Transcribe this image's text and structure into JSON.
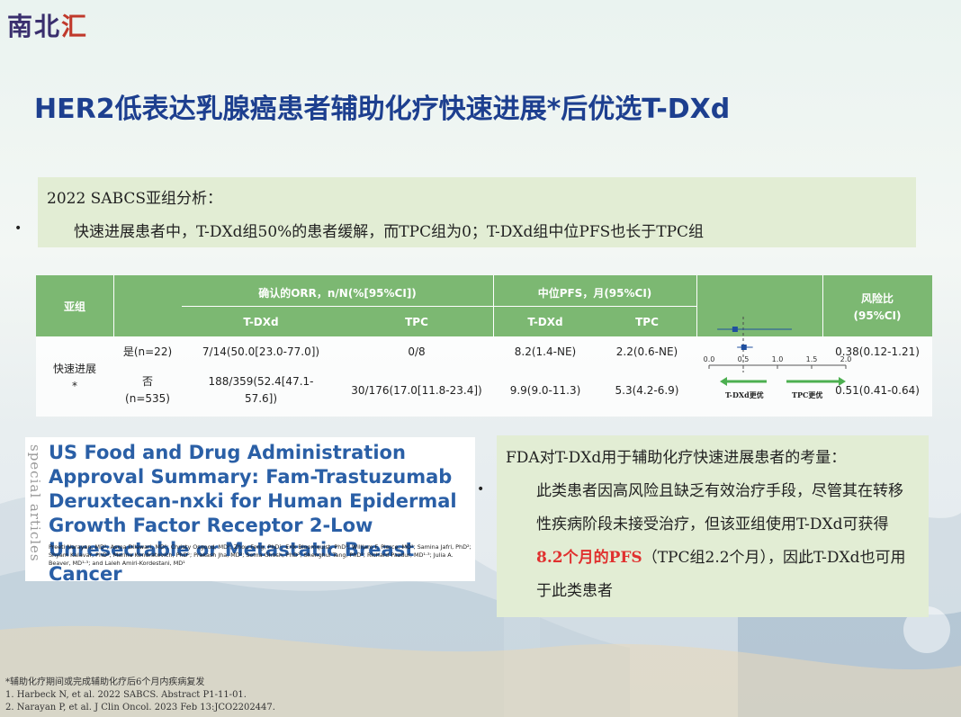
{
  "logo": {
    "part1": "南北",
    "part2": "汇"
  },
  "title": "HER2低表达乳腺癌患者辅助化疗快速进展*后优选T-DXd",
  "summary": {
    "heading": "2022 SABCS亚组分析：",
    "bullet": "•",
    "text": "快速进展患者中，T-DXd组50%的患者缓解，而TPC组为0；T-DXd组中位PFS也长于TPC组"
  },
  "table": {
    "col_subgroup": "亚组",
    "col_orr": "确认的ORR，n/N(%[95%CI])",
    "col_pfs": "中位PFS，月(95%CI)",
    "col_hr": "风险比",
    "col_hr_ci": "(95%CI)",
    "sub_tdxd": "T-DXd",
    "sub_tpc": "TPC",
    "sub_tdxd2": "T-DXd",
    "sub_tpc2": "TPC",
    "group_label": "快速进展",
    "group_star": "*",
    "rows": [
      {
        "label": "是(n=22)",
        "orr_tdxd": "7/14(50.0[23.0-77.0])",
        "orr_tpc": "0/8",
        "pfs_tdxd": "8.2(1.4-NE)",
        "pfs_tpc": "2.2(0.6-NE)",
        "hr": "0.38(0.12-1.21)"
      },
      {
        "label": "否",
        "label2": "(n=535)",
        "orr_tdxd": "188/359(52.4[47.1-",
        "orr_tdxd2": "57.6])",
        "orr_tpc": "30/176(17.0[11.8-23.4])",
        "pfs_tdxd": "9.9(9.0-11.3)",
        "pfs_tpc": "5.3(4.2-6.9)",
        "hr": "0.51(0.41-0.64)"
      }
    ],
    "forest": {
      "ticks": [
        "0.0",
        "0.5",
        "1.0",
        "1.5",
        "2.0"
      ],
      "left_label": "T-DXd更优",
      "right_label": "TPC更优",
      "points": [
        {
          "hr": 0.38,
          "lo": 0.12,
          "hi": 1.21
        },
        {
          "hr": 0.51,
          "lo": 0.41,
          "hi": 0.64
        }
      ],
      "colors": {
        "point": "#1f4fa0",
        "arrow": "#4caf50"
      }
    }
  },
  "paper": {
    "side": "special articles",
    "title": "US Food and Drug Administration Approval Summary: Fam-Trastuzumab Deruxtecan-nxki for Human Epidermal Growth Factor Receptor 2-Low Unresectable or Metastatic Breast Cancer",
    "authors": "Preeti Narayan, MD¹; Asma Dilawari, MD¹; Christy Osgood, MD¹; Zhou Feng, PhD¹; Erik Bloomquist, PhD¹; William F. Pierce, MD¹; Samina Jafri, PhD²; Shyam Kalavar, PhD²; Marina Kondratovich, PhD²; Prakash Jha, MD²; Soma Ghosh, PhD²; Shenghui Tang, PhD¹; Richard Pazdur, MD¹·³; Julia A. Beaver, MD¹·³; and Laleh Amiri-Kordestani, MD¹"
  },
  "fda": {
    "heading": "FDA对T-DXd用于辅助化疗快速进展患者的考量：",
    "bullet": "•",
    "text_a": "此类患者因高风险且缺乏有效治疗手段，尽管其在转移性疾病阶段未接受治疗，但该亚组使用T-DXd可获得",
    "highlight": "8.2个月的PFS",
    "text_b": "（TPC组2.2个月），因此T-DXd也可用于此类患者"
  },
  "footnotes": [
    "*辅助化疗期间或完成辅助化疗后6个月内疾病复发",
    "1. Harbeck N, et al. 2022 SABCS. Abstract P1-11-01.",
    "2. Narayan P, et al. J Clin Oncol. 2023 Feb 13:JCO2202447."
  ]
}
